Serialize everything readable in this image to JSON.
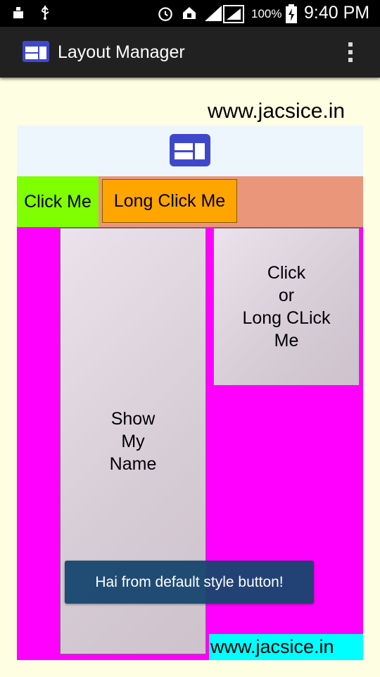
{
  "status_bar": {
    "icons": [
      "cleaner-icon",
      "usb-icon",
      "alarm-icon",
      "home-icon",
      "signal-icon",
      "signal-icon",
      "battery-charging-icon"
    ],
    "battery": "100%",
    "time": "9:40 PM"
  },
  "action_bar": {
    "icon": "layout-icon",
    "title": "Layout Manager",
    "overflow_icon": "overflow-menu-icon"
  },
  "content": {
    "site_top": "www.jacsice.in",
    "header_icon": "layout-icon",
    "click_me": "Click Me",
    "long_click_me": "Long Click Me",
    "show_name_lines": [
      "Show",
      "My",
      "Name"
    ],
    "click_or_lines": [
      "Click",
      "or",
      "Long CLick",
      "Me"
    ],
    "site_bottom": "www.jacsice.in",
    "toast": "Hai from default style button!"
  },
  "colors": {
    "background": "#fefee3",
    "header_band": "#eef6fd",
    "row": "#e9967a",
    "click_me": "#7fff00",
    "long_click": "#ffa500",
    "container": "#ff00ff",
    "site_bottom_bg": "#00ffff",
    "toast_bg": "#16466e",
    "icon_accent": "#3f48cc"
  }
}
